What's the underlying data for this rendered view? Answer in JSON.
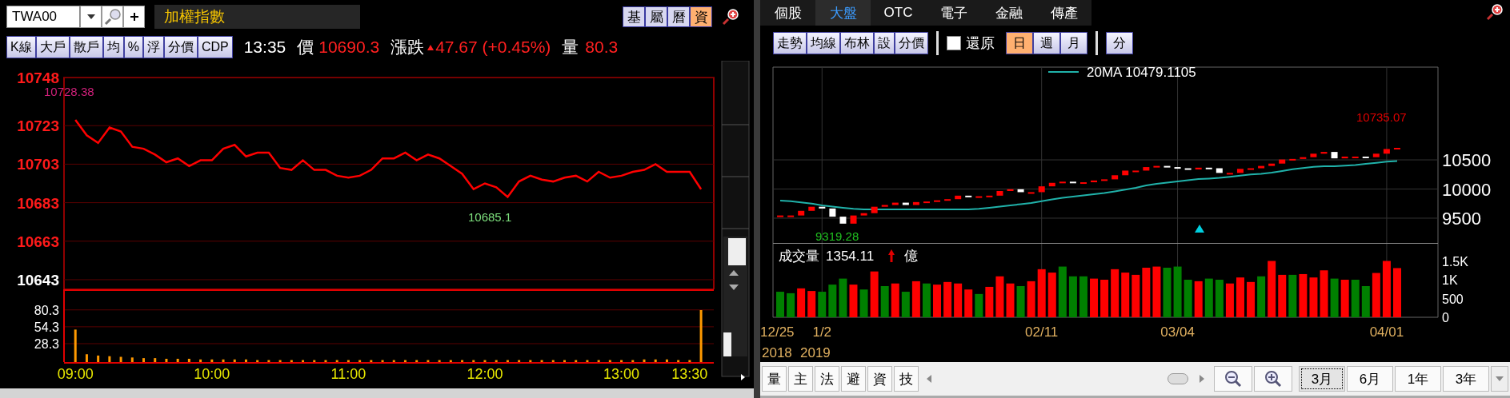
{
  "left_panel": {
    "symbol_field": {
      "value": "TWA00"
    },
    "title": "加權指數",
    "view_buttons": [
      {
        "label": "基",
        "selected": false
      },
      {
        "label": "屬",
        "selected": false
      },
      {
        "label": "曆",
        "selected": false
      },
      {
        "label": "資",
        "selected": true
      }
    ],
    "tool_buttons": [
      "K線",
      "大戶",
      "散戶",
      "均",
      "%",
      "浮",
      "分價",
      "CDP"
    ],
    "quote": {
      "time": "13:35",
      "price_label": "價",
      "price": "10690.3",
      "change_label": "漲跌",
      "change": "47.67 (+0.45%)",
      "volume_label": "量",
      "volume": "80.3"
    },
    "price_chart": {
      "high_label": "10728.38",
      "low_label": "10685.1",
      "chart_data": {
        "type": "line",
        "grid": true,
        "ylim": [
          10638,
          10748
        ],
        "categories": [
          null,
          null,
          null,
          null,
          null,
          null,
          null,
          null,
          null,
          null,
          null,
          null,
          null,
          null,
          null,
          null,
          null,
          null,
          null,
          null,
          null,
          null,
          null,
          null,
          null,
          null,
          null,
          null,
          null,
          null,
          null,
          null,
          null,
          null,
          null,
          null,
          null,
          null,
          null,
          null,
          null,
          null,
          null,
          null,
          null,
          null,
          null,
          null,
          null,
          null,
          null,
          null,
          null,
          null,
          null,
          null
        ],
        "yticks": [
          10748,
          10723,
          10703,
          10683,
          10663,
          10643
        ],
        "series": [
          {
            "color": "#ff0000",
            "values": [
              10726,
              10718,
              10714,
              10722,
              10720,
              10712,
              10711,
              10708,
              10704,
              10706,
              10702,
              10705,
              10705,
              10711,
              10713,
              10707,
              10709,
              10709,
              10701,
              10700,
              10705,
              10700,
              10700,
              10697,
              10696,
              10697,
              10700,
              10706,
              10706,
              10709,
              10705,
              10708,
              10706,
              10702,
              10698,
              10690,
              10693,
              10691,
              10686,
              10694,
              10697,
              10695,
              10694,
              10696,
              10697,
              10694,
              10699,
              10696,
              10697,
              10699,
              10700,
              10703,
              10699,
              10699,
              10699,
              10690
            ]
          }
        ]
      }
    },
    "volume_chart": {
      "chart_data": {
        "type": "bar",
        "grid": true,
        "ylim": [
          0,
          112
        ],
        "yticks": [
          {
            "value": 80.3,
            "label": "80.3"
          },
          {
            "value": 54.3,
            "label": "54.3"
          },
          {
            "value": 28.3,
            "label": "28.3"
          }
        ],
        "categories": [
          "09:00",
          null,
          null,
          null,
          null,
          null,
          null,
          null,
          null,
          null,
          null,
          null,
          "10:00",
          null,
          null,
          null,
          null,
          null,
          null,
          null,
          null,
          null,
          null,
          null,
          "11:00",
          null,
          null,
          null,
          null,
          null,
          null,
          null,
          null,
          null,
          null,
          null,
          "12:00",
          null,
          null,
          null,
          null,
          null,
          null,
          null,
          null,
          null,
          null,
          null,
          "13:00",
          null,
          null,
          null,
          null,
          null,
          "13:30",
          null
        ],
        "series": [
          {
            "color": "#ff9900",
            "values": [
              50,
              12,
              10,
              9,
              8,
              7,
              6,
              6,
              5,
              5,
              5,
              4,
              4,
              4,
              4,
              4,
              3,
              3,
              3,
              3,
              3,
              3,
              3,
              3,
              3,
              3,
              3,
              3,
              3,
              3,
              3,
              3,
              3,
              3,
              3,
              3,
              3,
              3,
              3,
              3,
              3,
              3,
              3,
              3,
              3,
              3,
              3,
              3,
              3,
              3,
              4,
              4,
              4,
              3,
              3,
              80
            ]
          }
        ]
      }
    }
  },
  "right_panel": {
    "tabs": [
      {
        "label": "個股",
        "selected": false
      },
      {
        "label": "大盤",
        "selected": true
      },
      {
        "label": "OTC",
        "selected": false
      },
      {
        "label": "電子",
        "selected": false
      },
      {
        "label": "金融",
        "selected": false
      },
      {
        "label": "傳產",
        "selected": false
      }
    ],
    "toolbar_buttons": [
      "走勢",
      "均線",
      "布林",
      "設",
      "分價"
    ],
    "restore_checkbox": {
      "label": "還原",
      "checked": false
    },
    "period_buttons": [
      {
        "label": "日",
        "selected": true
      },
      {
        "label": "週",
        "selected": false
      },
      {
        "label": "月",
        "selected": false
      }
    ],
    "minute_button": "分",
    "price_chart": {
      "legend_value": "10479.1105",
      "high_label": "10735.07",
      "low_label": "9319.28",
      "chart_data": {
        "type": "line",
        "grid": true,
        "ylim": [
          9075,
          12090
        ],
        "yticks": [
          9500,
          10000,
          10500
        ],
        "categories": [
          null,
          null,
          null,
          null,
          null,
          null,
          null,
          null,
          null,
          null,
          null,
          null,
          null,
          null,
          null,
          null,
          null,
          null,
          null,
          null,
          null,
          null,
          null,
          null,
          null,
          null,
          null,
          null,
          null,
          null,
          null,
          null,
          null,
          null,
          null,
          null,
          null,
          null,
          null,
          null,
          null,
          null,
          null,
          null,
          null,
          null,
          null,
          null,
          null,
          null,
          null,
          null,
          null,
          null,
          null,
          null,
          null,
          null,
          null,
          null
        ],
        "series": [
          {
            "name": "20MA",
            "color": "#20b2aa",
            "values": [
              9800,
              9790,
              9770,
              9750,
              9720,
              9700,
              9680,
              9660,
              9650,
              9650,
              9650,
              9650,
              9650,
              9650,
              9650,
              9650,
              9650,
              9650,
              9650,
              9660,
              9680,
              9700,
              9720,
              9740,
              9760,
              9790,
              9820,
              9850,
              9870,
              9890,
              9910,
              9930,
              9960,
              9990,
              10020,
              10060,
              10090,
              10110,
              10130,
              10150,
              10170,
              10180,
              10190,
              10210,
              10230,
              10250,
              10260,
              10280,
              10310,
              10340,
              10360,
              10380,
              10390,
              10390,
              10400,
              10410,
              10430,
              10450,
              10470,
              10480
            ]
          }
        ]
      }
    },
    "volume_chart": {
      "title": "成交量",
      "value": "1354.11",
      "unit": "億",
      "chart_data": {
        "type": "bar",
        "stacked": true,
        "grid": true,
        "ylim": [
          0,
          1979
        ],
        "yticks": [
          {
            "value": 0,
            "label": "0"
          },
          {
            "value": 500,
            "label": "500"
          },
          {
            "value": 1000,
            "label": "1K"
          },
          {
            "value": 1500,
            "label": "1.5K"
          }
        ],
        "categories": [
          "12/25",
          null,
          null,
          null,
          "1/2",
          null,
          null,
          null,
          null,
          null,
          null,
          null,
          null,
          null,
          null,
          null,
          null,
          null,
          null,
          null,
          null,
          null,
          null,
          null,
          null,
          "02/11",
          null,
          null,
          null,
          null,
          null,
          null,
          null,
          null,
          null,
          null,
          null,
          null,
          "03/04",
          null,
          null,
          null,
          null,
          null,
          null,
          null,
          null,
          null,
          null,
          null,
          null,
          null,
          null,
          null,
          null,
          null,
          null,
          null,
          "04/01",
          null
        ],
        "series": [
          {
            "color": "#ff0000",
            "values": [
              null,
              null,
              770,
              700,
              null,
              null,
              null,
              870,
              null,
              1220,
              null,
              900,
              null,
              960,
              null,
              870,
              940,
              900,
              740,
              null,
              810,
              1090,
              900,
              null,
              960,
              1280,
              1190,
              null,
              null,
              null,
              1030,
              1000,
              1280,
              1190,
              1130,
              1320,
              1350,
              null,
              null,
              null,
              960,
              null,
              null,
              900,
              1060,
              940,
              null,
              1500,
              1130,
              null,
              1150,
              1060,
              1250,
              null,
              1000,
              null,
              null,
              1180,
              1500,
              1310
            ]
          },
          {
            "color": "#008000",
            "values": [
              680,
              640,
              null,
              null,
              680,
              870,
              1030,
              null,
              740,
              null,
              830,
              null,
              680,
              null,
              900,
              null,
              null,
              null,
              null,
              620,
              null,
              null,
              null,
              830,
              null,
              null,
              null,
              1350,
              1090,
              1090,
              null,
              null,
              null,
              null,
              null,
              null,
              null,
              1320,
              1350,
              1000,
              null,
              1030,
              1000,
              null,
              null,
              null,
              1090,
              null,
              null,
              1130,
              null,
              null,
              null,
              1030,
              null,
              1000,
              830,
              null,
              null,
              null
            ]
          }
        ]
      }
    },
    "year_labels": [
      "2018",
      "2019"
    ],
    "bottom_buttons": [
      "量",
      "主",
      "法",
      "避",
      "資",
      "技"
    ],
    "range_buttons": [
      {
        "label": "3月",
        "selected": true
      },
      {
        "label": "6月",
        "selected": false
      },
      {
        "label": "1年",
        "selected": false
      },
      {
        "label": "3年",
        "selected": false
      }
    ]
  }
}
